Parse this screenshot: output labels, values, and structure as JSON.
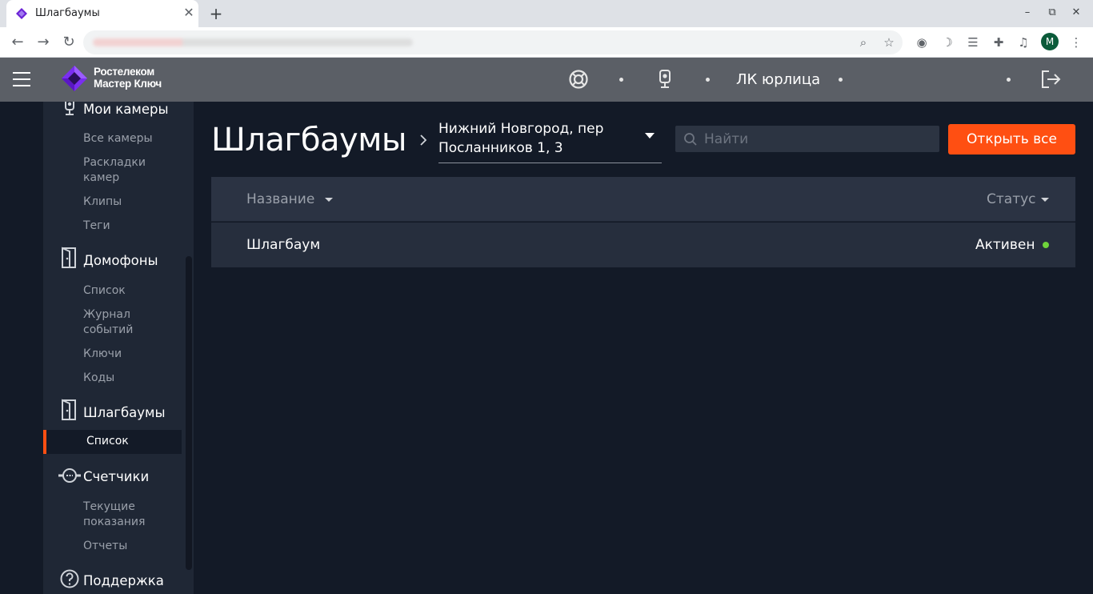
{
  "browser": {
    "tab_title": "Шлагбаумы",
    "profile_initial": "M"
  },
  "header": {
    "logo_line1": "Ростелеком",
    "logo_line2": "Мастер Ключ",
    "account_label": "ЛК юрлица"
  },
  "sidebar": {
    "sections": [
      {
        "title": "Мои камеры",
        "items": [
          "Все камеры",
          "Раскладки камер",
          "Клипы",
          "Теги"
        ]
      },
      {
        "title": "Домофоны",
        "items": [
          "Список",
          "Журнал событий",
          "Ключи",
          "Коды"
        ]
      },
      {
        "title": "Шлагбаумы",
        "items": [
          "Список"
        ],
        "active_item": "Список"
      },
      {
        "title": "Счетчики",
        "items": [
          "Текущие показания",
          "Отчеты"
        ]
      },
      {
        "title": "Поддержка",
        "items": []
      }
    ]
  },
  "main": {
    "title": "Шлагбаумы",
    "address_select": "Нижний Новгород, пер Посланников 1, 3",
    "search_placeholder": "Найти",
    "open_all_button": "Открыть все",
    "table": {
      "columns": [
        "Название",
        "Статус"
      ],
      "rows": [
        {
          "name": "Шлагбаум",
          "status": "Активен",
          "status_color": "#6fd33b"
        }
      ]
    }
  },
  "colors": {
    "accent": "#ff4f12",
    "background": "#131a27",
    "sidebar": "#1f2735",
    "header": "#5b5f66"
  }
}
